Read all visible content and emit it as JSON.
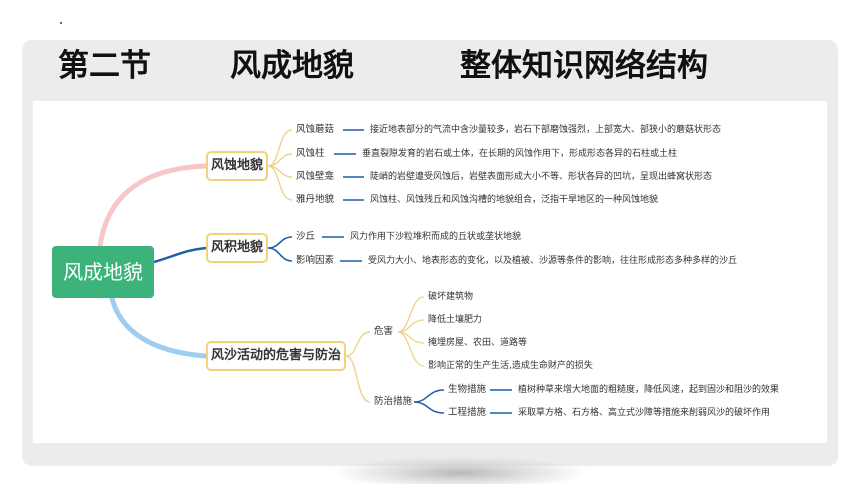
{
  "title": {
    "part1": "第二节",
    "part2": "风成地貌",
    "part3": "整体知识网络结构"
  },
  "root": "风成地貌",
  "branches": [
    {
      "label": "风蚀地貌",
      "items": [
        {
          "term": "风蚀蘑菇",
          "desc": "接近地表部分的气流中含沙量较多，岩石下部磨蚀强烈，上部宽大、部狭小的蘑菇状形态"
        },
        {
          "term": "风蚀柱",
          "desc": "垂直裂隙发育的岩石或土体，在长期的风蚀作用下，形成形态各异的石柱或土柱"
        },
        {
          "term": "风蚀壁龛",
          "desc": "陡峭的岩壁遭受风蚀后，岩壁表面形成大小不等、形状各异的凹坑，呈现出蜂窝状形态"
        },
        {
          "term": "雅丹地貌",
          "desc": "风蚀柱、风蚀残丘和风蚀沟槽的地貌组合，泛指干旱地区的一种风蚀地貌"
        }
      ]
    },
    {
      "label": "风积地貌",
      "items": [
        {
          "term": "沙丘",
          "desc": "风力作用下沙粒堆积而成的丘状或垄状地貌"
        },
        {
          "term": "影响因素",
          "desc": "受风力大小、地表形态的变化，以及植被、沙源等条件的影响，往往形成形态多种多样的沙丘"
        }
      ]
    },
    {
      "label": "风沙活动的危害与防治",
      "harm": {
        "label": "危害",
        "items": [
          "破坏建筑物",
          "降低土壤肥力",
          "掩埋房屋、农田、道路等",
          "影响正常的生产生活,造成生命财产的损失"
        ]
      },
      "prevention": {
        "label": "防治措施",
        "items": [
          {
            "term": "生物措施",
            "desc": "植树种草来增大地面的粗糙度，降低风速，起到固沙和阻沙的效果"
          },
          {
            "term": "工程措施",
            "desc": "采取草方格、石方格、高立式沙障等措施来削弱风沙的破坏作用"
          }
        ]
      }
    }
  ],
  "colors": {
    "root": "#3bb37a",
    "branch_border": "#f3d27b",
    "curve_pink": "#f7c7c7",
    "curve_blue": "#1f5fa8",
    "curve_lightblue": "#9fcdf0",
    "bracket": "#f0d38a",
    "item_line": "#1f5fa8"
  }
}
